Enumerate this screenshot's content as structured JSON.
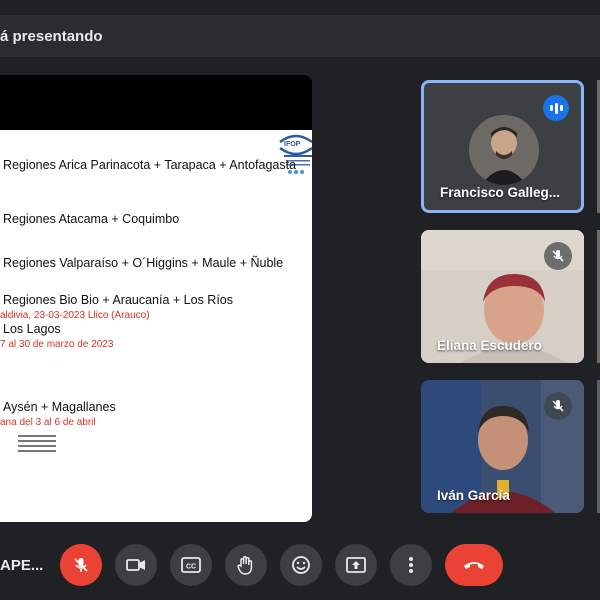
{
  "header": {
    "presenting_text": "á presentando"
  },
  "slide": {
    "lines": [
      "Regiones Arica Parinacota + Tarapaca + Antofagasta",
      "Regiones Atacama + Coquimbo",
      "Regiones Valparaíso + O´Higgins + Maule + Ñuble",
      "Regiones Bio Bio + Araucanía + Los Ríos",
      "aldivia, 23-03-2023 Llico (Arauco)",
      "Los Lagos",
      "7 al 30 de marzo de 2023",
      "Aysén + Magallanes",
      "ana del 3 al 6 de abril"
    ],
    "logo_text": "IFOP"
  },
  "participants": [
    {
      "name": "Francisco Galleg...",
      "state": "speaking"
    },
    {
      "name": "Eliana Escudero",
      "state": "muted"
    },
    {
      "name": "Iván García",
      "state": "muted"
    }
  ],
  "controls": {
    "meeting_code": "APE...",
    "buttons": [
      "mic-off",
      "camera",
      "captions",
      "raise-hand",
      "emoji",
      "present",
      "more",
      "end-call"
    ]
  },
  "colors": {
    "background": "#202124",
    "accent": "#8ab4f8",
    "danger": "#ea4335",
    "speaking": "#1a73e8"
  }
}
